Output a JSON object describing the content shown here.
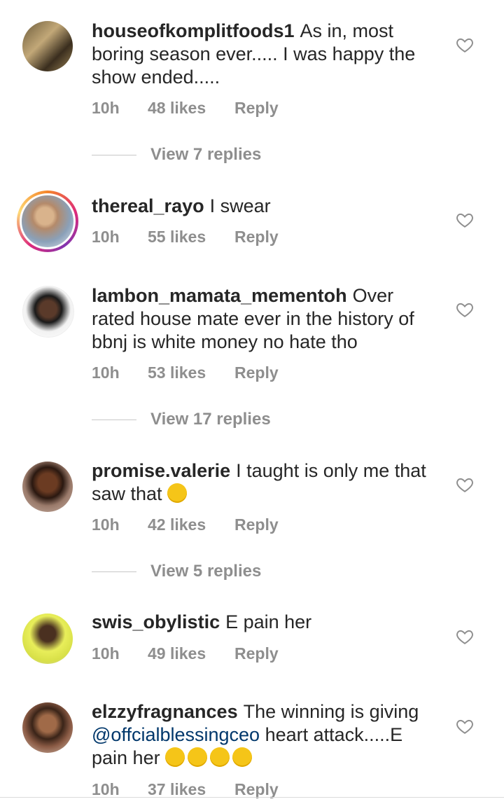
{
  "comments": [
    {
      "username": "houseofkomplitfoods1",
      "text": "As in, most boring season ever..... I was happy the show ended.....",
      "time": "10h",
      "likes": "48 likes",
      "reply": "Reply",
      "view_replies": "View 7 replies"
    },
    {
      "username": "thereal_rayo",
      "text": "I swear",
      "time": "10h",
      "likes": "55 likes",
      "reply": "Reply"
    },
    {
      "username": "lambon_mamata_mementoh",
      "text": "Over rated house mate ever in the history of bbnj is white money no hate tho",
      "time": "10h",
      "likes": "53 likes",
      "reply": "Reply",
      "view_replies": "View 17 replies"
    },
    {
      "username": "promise.valerie",
      "text": "I taught is only me that saw that",
      "emoji": "tears-of-joy-emoji",
      "time": "10h",
      "likes": "42 likes",
      "reply": "Reply",
      "view_replies": "View 5 replies"
    },
    {
      "username": "swis_obylistic",
      "text": "E pain her",
      "time": "10h",
      "likes": "49 likes",
      "reply": "Reply"
    },
    {
      "username": "elzzyfragnances",
      "text_before": "The winning  is giving",
      "mention": "@offcialblessingceo",
      "text_after": "heart attack.....E pain her",
      "emoji": "tongue-out-emoji",
      "emoji_count": 4,
      "time": "10h",
      "likes": "37 likes",
      "reply": "Reply"
    }
  ]
}
